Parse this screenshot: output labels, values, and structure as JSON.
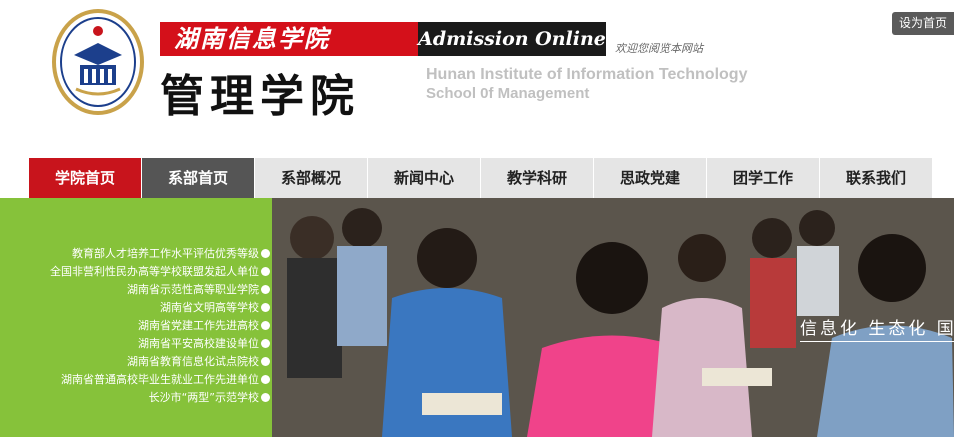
{
  "header": {
    "logo_text": "湖南信息学院 Hunan Institute of Information Technology",
    "cn_name": "湖南信息学院",
    "admission": "Admission Online",
    "welcome": "欢迎您阅览本网站",
    "school": "管理学院",
    "en_line1": "Hunan Institute of Information Technology",
    "en_line2": "School 0f Management",
    "set_home": "设为首页"
  },
  "nav": {
    "items": [
      {
        "label": "学院首页",
        "state": "active"
      },
      {
        "label": "系部首页",
        "state": "selected"
      },
      {
        "label": "系部概况"
      },
      {
        "label": "新闻中心"
      },
      {
        "label": "教学科研"
      },
      {
        "label": "思政党建"
      },
      {
        "label": "团学工作"
      },
      {
        "label": "联系我们"
      }
    ]
  },
  "banner": {
    "honors": [
      "教育部人才培养工作水平评估优秀等级",
      "全国非营利性民办高等学校联盟发起人单位",
      "湖南省示范性高等职业学院",
      "湖南省文明高等学校",
      "湖南省党建工作先进高校",
      "湖南省平安高校建设单位",
      "湖南省教育信息化试点院校",
      "湖南省普通高校毕业生就业工作先进单位",
      "长沙市“两型”示范学校"
    ],
    "slogan": "信息化  生态化  国"
  },
  "colors": {
    "brand_red": "#c8141c",
    "panel_green": "#86c23a",
    "nav_gray": "#e5e5e5",
    "nav_dark": "#555555"
  }
}
